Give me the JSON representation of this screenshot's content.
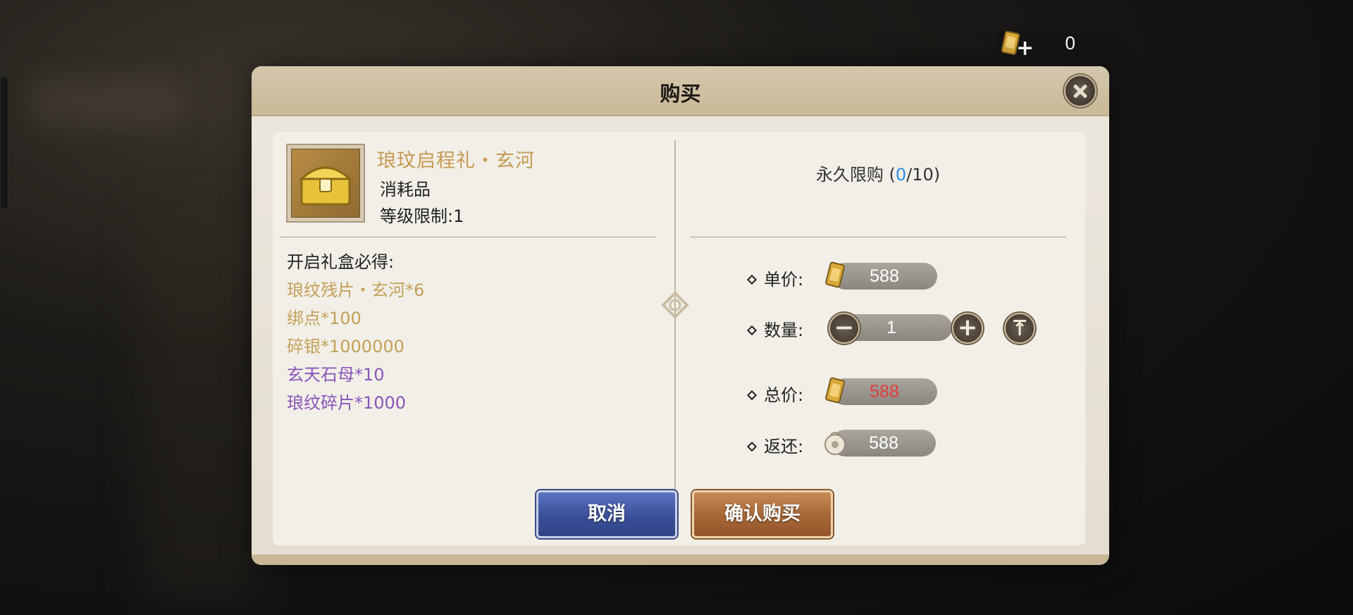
{
  "currency": {
    "value": "0",
    "icon": "currency-scroll-icon"
  },
  "dialog": {
    "title": "购买",
    "item": {
      "name": "琅玟启程礼・玄河",
      "type": "消耗品",
      "level": "等级限制:1",
      "icon": "treasure-chest-icon"
    },
    "rewards_title": "开启礼盒必得:",
    "rewards": [
      {
        "text": "琅纹残片・玄河*6",
        "color": "#c4a058"
      },
      {
        "text": "绑点*100",
        "color": "#c4a058"
      },
      {
        "text": "碎银*1000000",
        "color": "#c4a058"
      },
      {
        "text": "玄天石母*10",
        "color": "#8a55b8"
      },
      {
        "text": "琅纹碎片*1000",
        "color": "#8a55b8"
      }
    ],
    "limit": {
      "prefix": "永久限购 (",
      "current": "0",
      "suffix": "/10)"
    },
    "unit_price": {
      "label": "单价:",
      "value": "588"
    },
    "quantity": {
      "label": "数量:",
      "value": "1"
    },
    "total": {
      "label": "总价:",
      "value": "588",
      "color": "#e23b3b"
    },
    "refund": {
      "label": "返还:",
      "value": "588"
    },
    "buttons": {
      "cancel": "取消",
      "confirm": "确认购买"
    }
  }
}
